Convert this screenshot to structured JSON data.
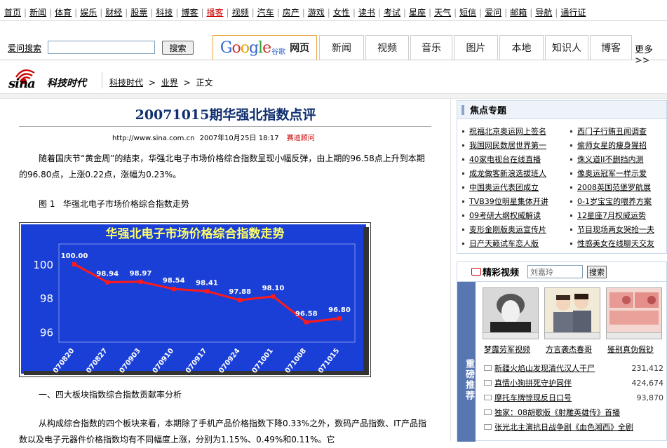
{
  "topnav": [
    "首页",
    "新闻",
    "体育",
    "娱乐",
    "财经",
    "股票",
    "科技",
    "博客",
    "播客",
    "视频",
    "汽车",
    "房产",
    "游戏",
    "女性",
    "读书",
    "考试",
    "星座",
    "天气",
    "短信",
    "爱问",
    "邮箱",
    "导航",
    "通行证"
  ],
  "search": {
    "ask_label": "爱问搜索",
    "input_value": "",
    "button_label": "搜索",
    "google_logo_text": "Google",
    "google_cn": "谷歌",
    "tabs": [
      "网页",
      "新闻",
      "视频",
      "音乐",
      "图片",
      "本地",
      "知识人",
      "博客"
    ],
    "more_label": "更多>>"
  },
  "brand": {
    "logo_text": "sina",
    "channel": "科技时代",
    "breadcrumb": [
      "科技时代",
      "业界",
      "正文"
    ],
    "sep": ">"
  },
  "article": {
    "title": "20071015期华强北指数点评",
    "url": "http://www.sina.com.cn",
    "date": "2007年10月25日 18:17",
    "advisor": "赛迪顾问",
    "para1": "随着国庆节“黄金周”的结束，华强北电子市场价格综合指数呈现小幅反弹，由上期的96.58点上升到本期的96.80点，上涨0.22点，涨幅为0.23%。",
    "figure_label": "图 1   华强北电子市场价格综合指数走势",
    "section": "一、四大板块指数综合指数贡献率分析",
    "para2": "从构成综合指数的四个板块来看，本期除了手机产品价格指数下降0.33%之外，数码产品指数、IT产品指数以及电子元器件价格指数均有不同幅度上涨，分别为1.15%、0.49%和0.11%。它"
  },
  "chart_data": {
    "type": "line",
    "title": "华强北电子市场价格综合指数走势",
    "categories": [
      "070820",
      "070827",
      "070903",
      "070910",
      "070917",
      "070924",
      "071001",
      "071008",
      "071015"
    ],
    "values": [
      100.0,
      98.94,
      98.97,
      98.54,
      98.41,
      97.88,
      98.1,
      96.58,
      96.8
    ],
    "data_labels": [
      "100.00",
      "98.94",
      "98.97",
      "98.54",
      "98.41",
      "97.88",
      "98.10",
      "96.58",
      "96.80"
    ],
    "y_ticks": [
      96,
      98,
      100
    ],
    "ylim": [
      95.4,
      101.2
    ],
    "grid": false,
    "colors": {
      "background": "#1a3fd6",
      "line": "#ff1a1a",
      "title": "#ffff66",
      "text": "#ffffff"
    }
  },
  "focus": {
    "title": "焦点专题",
    "col1": [
      "祝福北京奥运网上签名",
      "我国网民数居世界第一",
      "40家电视台在线直播",
      "成龙做客新浪选拔班人",
      "中国奥运代表团成立",
      "TVB39位明星集体开讲",
      "09考研大纲权威解读",
      "变形金刚版奥运宣传片",
      "日产天籁试车恋人版"
    ],
    "col2": [
      "西门子行贿丑闻调查",
      "偷师女星的瘦身猩招",
      "侏义道II不删挡内测",
      "像奥运冠军一样示爱",
      "2008英国范堡罗航展",
      "0-1岁宝宝的喂养方案",
      "12星座7月权威运势",
      "节目现场两女哭抢一夫",
      "性感美女在线聊天交友"
    ]
  },
  "video": {
    "title": "精彩视频",
    "input_value": "刘嘉玲",
    "button_label": "搜索",
    "side_label": "重磅推荐",
    "thumbs": [
      "梦露劳军视频",
      "方言袭杰春哥",
      "鉴别真伪假钞"
    ],
    "rows": [
      {
        "title": "新疆火焰山发现清代汉人干尸",
        "count": "231,412"
      },
      {
        "title": "真情小狗拼死守护同伴",
        "count": "424,674"
      },
      {
        "title": "摩托车牌惊现反日口号",
        "count": "93,870"
      },
      {
        "title": "独家：08胡歌版《射雕英雄传》首播",
        "count": ""
      },
      {
        "title": "张光北主演抗日战争剧《血色湘西》全剧",
        "count": ""
      }
    ]
  }
}
